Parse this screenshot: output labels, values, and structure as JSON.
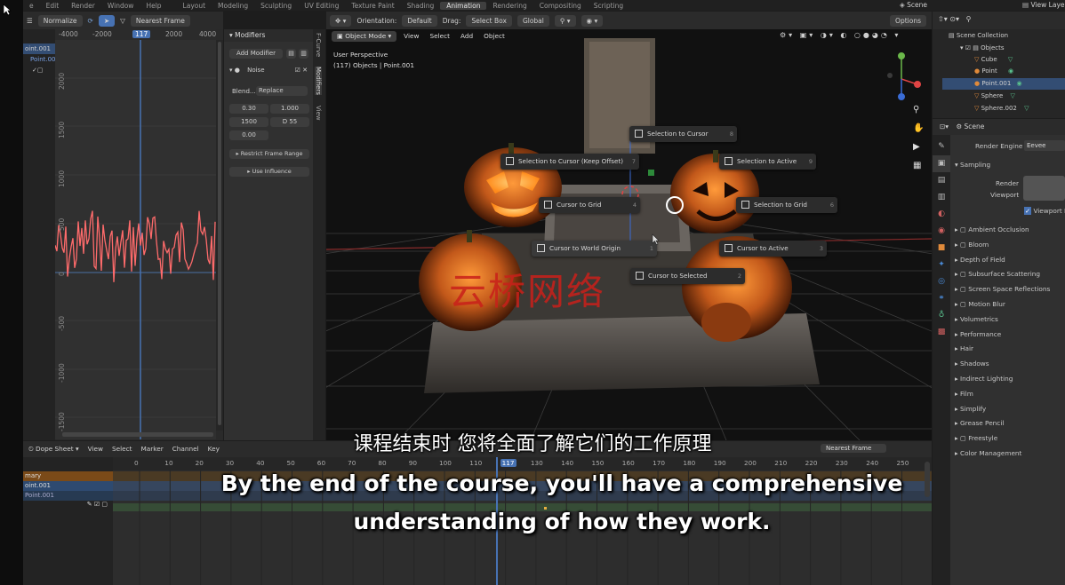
{
  "topbar": {
    "menus": [
      "e",
      "Edit",
      "Render",
      "Window",
      "Help"
    ],
    "workspaces": [
      "Layout",
      "Modeling",
      "Sculpting",
      "UV Editing",
      "Texture Paint",
      "Shading",
      "Animation",
      "Rendering",
      "Compositing",
      "Scripting"
    ],
    "active_workspace": "Animation",
    "scene": "Scene",
    "view_layer": "View Laye"
  },
  "graph_editor": {
    "normalize_label": "Normalize",
    "interp_label": "Nearest Frame",
    "channels": [
      "oint.001",
      "Point.00"
    ],
    "x_ticks": [
      "-4000",
      "-2000",
      "117",
      "2000",
      "4000"
    ],
    "y_ticks": [
      "2000",
      "1500",
      "1000",
      "500",
      "0",
      "-500",
      "-1000",
      "-1500"
    ],
    "current_frame": "117"
  },
  "modifiers": {
    "header": "Modifiers",
    "add_modifier": "Add Modifier",
    "noise_label": "Noise",
    "blend_label": "Blend...",
    "blend_value": "Replace",
    "values": [
      "0.30",
      "1.000",
      "1500",
      "D  55",
      "0.00"
    ],
    "restrict_range": "Restrict Frame Range",
    "use_influence": "Use Influence",
    "side_tabs": [
      "F-Curve",
      "Modifiers",
      "View"
    ]
  },
  "viewport": {
    "orientation_label": "Orientation:",
    "orientation_value": "Default",
    "drag_label": "Drag:",
    "drag_value": "Select Box",
    "transform_value": "Global",
    "options_label": "Options",
    "mode": "Object Mode",
    "menu": [
      "View",
      "Select",
      "Add",
      "Object"
    ],
    "info_line1": "User Perspective",
    "info_line2": "(117) Objects | Point.001",
    "pie_menu": [
      {
        "label": "Selection to Cursor",
        "num": "8"
      },
      {
        "label": "Selection to Cursor (Keep Offset)",
        "num": "7"
      },
      {
        "label": "Selection to Active",
        "num": "9"
      },
      {
        "label": "Cursor to Grid",
        "num": "4"
      },
      {
        "label": "Selection to Grid",
        "num": "6"
      },
      {
        "label": "Cursor to World Origin",
        "num": "1"
      },
      {
        "label": "Cursor to Active",
        "num": "3"
      },
      {
        "label": "Cursor to Selected",
        "num": "2"
      }
    ],
    "watermark": "云桥网络"
  },
  "outliner": {
    "title": "Scene Collection",
    "items": [
      "Objects",
      "Cube",
      "Point",
      "Point.001",
      "Sphere",
      "Sphere.002"
    ],
    "selected": "Point.001"
  },
  "properties": {
    "scene_label": "Scene",
    "render_engine_label": "Render Engine",
    "render_engine_value": "Eevee",
    "sampling": "Sampling",
    "render_label": "Render",
    "viewport_label": "Viewport",
    "viewport_denoise": "Viewport D",
    "panels": [
      "Ambient Occlusion",
      "Bloom",
      "Depth of Field",
      "Subsurface Scattering",
      "Screen Space Reflections",
      "Motion Blur",
      "Volumetrics",
      "Performance",
      "Hair",
      "Shadows",
      "Indirect Lighting",
      "Film",
      "Simplify",
      "Grease Pencil",
      "Freestyle",
      "Color Management"
    ]
  },
  "dopesheet": {
    "mode": "Dope Sheet",
    "menu": [
      "View",
      "Select",
      "Marker",
      "Channel",
      "Key"
    ],
    "interp": "Nearest Frame",
    "channels": [
      "mary",
      "oint.001",
      "Point.001"
    ],
    "frame_ticks": [
      "0",
      "10",
      "20",
      "30",
      "40",
      "50",
      "60",
      "70",
      "80",
      "90",
      "100",
      "110",
      "117",
      "130",
      "140",
      "150",
      "160",
      "170",
      "180",
      "190",
      "200",
      "210",
      "220",
      "230",
      "240",
      "250"
    ],
    "current_frame": "117"
  },
  "subtitles": {
    "zh": "课程结束时 您将全面了解它们的工作原理",
    "en_line1": "By the end of the course, you'll have a comprehensive",
    "en_line2": "understanding of how they work."
  },
  "colors": {
    "accent_blue": "#4772b3",
    "curve_red": "#ff6b6b",
    "orange": "#d9822b"
  }
}
